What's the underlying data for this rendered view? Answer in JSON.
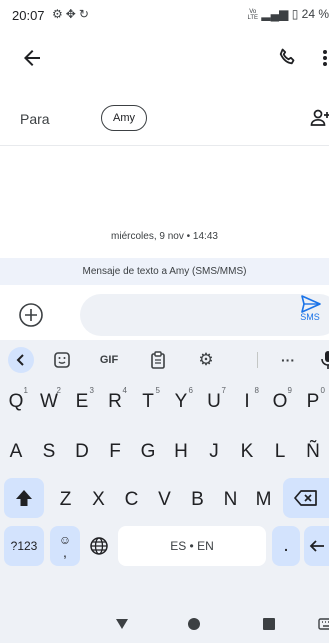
{
  "status_bar": {
    "time": "20:07",
    "icons": [
      "gear-icon",
      "fan-icon",
      "sync-icon"
    ],
    "network_top": "Vo",
    "network_bottom": "LTE",
    "battery_percent": "24 %"
  },
  "header": {
    "back_icon": "arrow-left-icon",
    "call_icon": "phone-icon",
    "more_icon": "more-vert-icon"
  },
  "recipient": {
    "label": "Para",
    "chip": "Amy",
    "add_icon": "group-add-icon"
  },
  "conversation": {
    "date": "miércoles, 9 nov • 14:43",
    "info": "Mensaje de texto a Amy (SMS/MMS)"
  },
  "compose": {
    "value": "",
    "send_label": "SMS"
  },
  "keyboard": {
    "toolbar": {
      "gif": "GIF",
      "more": "···"
    },
    "row1": [
      {
        "key": "Q",
        "hint": "1"
      },
      {
        "key": "W",
        "hint": "2"
      },
      {
        "key": "E",
        "hint": "3"
      },
      {
        "key": "R",
        "hint": "4"
      },
      {
        "key": "T",
        "hint": "5"
      },
      {
        "key": "Y",
        "hint": "6"
      },
      {
        "key": "U",
        "hint": "7"
      },
      {
        "key": "I",
        "hint": "8"
      },
      {
        "key": "O",
        "hint": "9"
      },
      {
        "key": "P",
        "hint": "0"
      }
    ],
    "row2": [
      "A",
      "S",
      "D",
      "F",
      "G",
      "H",
      "J",
      "K",
      "L",
      "Ñ"
    ],
    "row3": [
      "Z",
      "X",
      "C",
      "V",
      "B",
      "N",
      "M"
    ],
    "symbols_label": "?123",
    "emoji_comma": ",",
    "space_label": "ES • EN",
    "period": "."
  },
  "colors": {
    "accent": "#1a73e8",
    "keyboard_bg": "#eef1f6",
    "key_dark": "#d3e3fd"
  }
}
